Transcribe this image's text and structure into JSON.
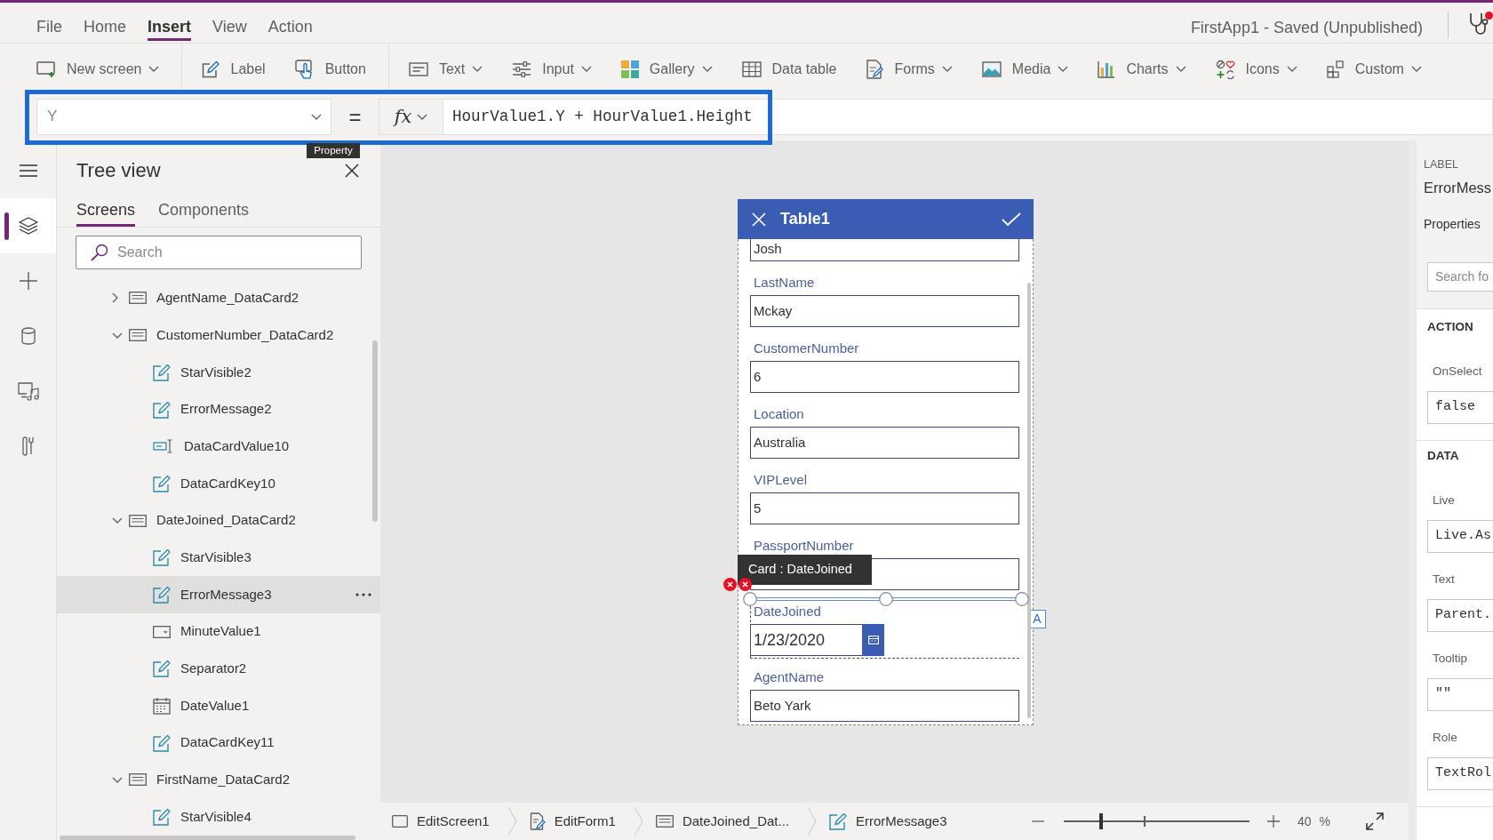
{
  "window": {
    "title": "FirstApp1 - Saved (Unpublished)"
  },
  "menu": [
    {
      "label": "File",
      "selected": false
    },
    {
      "label": "Home",
      "selected": false
    },
    {
      "label": "Insert",
      "selected": true
    },
    {
      "label": "View",
      "selected": false
    },
    {
      "label": "Action",
      "selected": false
    }
  ],
  "toolbar": [
    {
      "label": "New screen",
      "dropdown": true
    },
    {
      "label": "Label",
      "dropdown": false
    },
    {
      "label": "Button",
      "dropdown": false
    },
    {
      "label": "Text",
      "dropdown": true
    },
    {
      "label": "Input",
      "dropdown": true
    },
    {
      "label": "Gallery",
      "dropdown": true
    },
    {
      "label": "Data table",
      "dropdown": false
    },
    {
      "label": "Forms",
      "dropdown": true
    },
    {
      "label": "Media",
      "dropdown": true
    },
    {
      "label": "Charts",
      "dropdown": true
    },
    {
      "label": "Icons",
      "dropdown": true
    },
    {
      "label": "Custom",
      "dropdown": true
    }
  ],
  "formula_bar": {
    "property": "Y",
    "property_tooltip": "Property",
    "equals": "=",
    "function_label": "fx",
    "formula": "HourValue1.Y + HourValue1.Height"
  },
  "rail": [
    {
      "selected": true
    },
    {
      "selected": false
    },
    {
      "selected": false
    },
    {
      "selected": false
    },
    {
      "selected": false
    }
  ],
  "tree_view": {
    "title": "Tree view",
    "tabs": [
      {
        "label": "Screens",
        "selected": true
      },
      {
        "label": "Components",
        "selected": false
      }
    ],
    "search": {
      "placeholder": "Search"
    },
    "items": [
      {
        "label": "AgentName_DataCard2",
        "kind": "card",
        "expanded": false,
        "selected": false
      },
      {
        "label": "CustomerNumber_DataCard2",
        "kind": "card",
        "expanded": true,
        "selected": false,
        "children": [
          {
            "label": "StarVisible2",
            "kind": "label",
            "selected": false
          },
          {
            "label": "ErrorMessage2",
            "kind": "label",
            "selected": false
          },
          {
            "label": "DataCardValue10",
            "kind": "text_input",
            "selected": false
          },
          {
            "label": "DataCardKey10",
            "kind": "label",
            "selected": false
          }
        ]
      },
      {
        "label": "DateJoined_DataCard2",
        "kind": "card",
        "expanded": true,
        "selected": false,
        "children": [
          {
            "label": "StarVisible3",
            "kind": "label",
            "selected": false
          },
          {
            "label": "ErrorMessage3",
            "kind": "label",
            "selected": true
          },
          {
            "label": "MinuteValue1",
            "kind": "dropdown",
            "selected": false
          },
          {
            "label": "Separator2",
            "kind": "label",
            "selected": false
          },
          {
            "label": "DateValue1",
            "kind": "date_picker",
            "selected": false
          },
          {
            "label": "DataCardKey11",
            "kind": "label",
            "selected": false
          }
        ]
      },
      {
        "label": "FirstName_DataCard2",
        "kind": "card",
        "expanded": true,
        "selected": false,
        "children": [
          {
            "label": "StarVisible4",
            "kind": "label",
            "selected": false
          }
        ]
      }
    ]
  },
  "form": {
    "title": "Table1",
    "selection_tooltip": "Card : DateJoined",
    "text_badge": "A",
    "fields": [
      {
        "kind": "text",
        "value": "Josh",
        "selected": false
      },
      {
        "kind": "text",
        "label": "LastName",
        "value": "Mckay",
        "selected": false
      },
      {
        "kind": "text",
        "label": "CustomerNumber",
        "value": "6",
        "selected": false
      },
      {
        "kind": "text",
        "label": "Location",
        "value": "Australia",
        "selected": false
      },
      {
        "kind": "text",
        "label": "VIPLevel",
        "value": "5",
        "selected": false
      },
      {
        "kind": "text",
        "label": "PassportNumber",
        "selected": false
      },
      {
        "kind": "date",
        "label": "DateJoined",
        "value": "1/23/2020",
        "selected": true
      },
      {
        "kind": "text",
        "label": "AgentName",
        "value": "Beto Yark",
        "selected": false
      }
    ]
  },
  "properties_panel": {
    "control_type": "LABEL",
    "control_name": "ErrorMess",
    "tab": "Properties",
    "search": {
      "placeholder": "Search fo"
    },
    "sections": [
      {
        "title": "ACTION",
        "properties": [
          {
            "name": "OnSelect",
            "value": "false"
          }
        ]
      },
      {
        "title": "DATA",
        "properties": [
          {
            "name": "Live",
            "value": "Live.As"
          },
          {
            "name": "Text",
            "value": "Parent."
          },
          {
            "name": "Tooltip",
            "value": "\"\""
          },
          {
            "name": "Role",
            "value": "TextRol"
          }
        ]
      }
    ]
  },
  "status_bar": {
    "breadcrumbs": [
      {
        "label": "EditScreen1",
        "kind": "screen"
      },
      {
        "label": "EditForm1",
        "kind": "form"
      },
      {
        "label": "DateJoined_Dat...",
        "kind": "card"
      },
      {
        "label": "ErrorMessage3",
        "kind": "label"
      }
    ],
    "zoom": {
      "level": 0.2,
      "reading": "40",
      "unit": "%"
    }
  }
}
